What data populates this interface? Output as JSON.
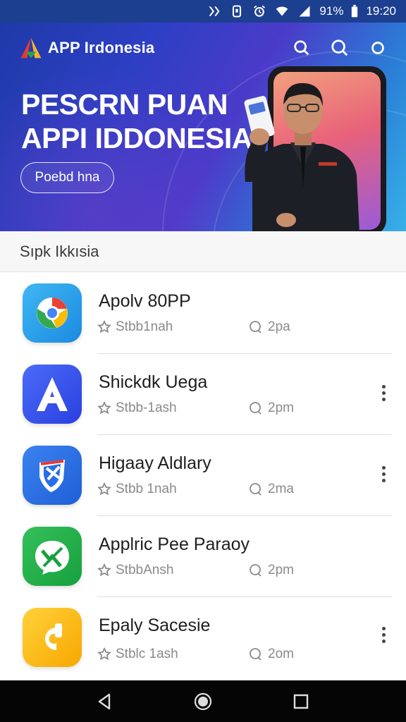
{
  "status_bar": {
    "battery": "91%",
    "time": "19:20",
    "icons": [
      "nfc-icon",
      "vibrate-icon",
      "alarm-icon",
      "wifi-icon",
      "signal-icon",
      "battery-icon"
    ]
  },
  "header": {
    "app_title": "APP Irdonesia",
    "actions": [
      "search-icon",
      "search-icon",
      "circle-icon"
    ]
  },
  "hero": {
    "title_line1": "PESCRN PUAN",
    "title_line2": "APPI IDDONESIA",
    "button_label": "Poebd hna"
  },
  "section": {
    "title": "Sıpk Ikkısia"
  },
  "apps": [
    {
      "name": "Apolv 80PP",
      "meta_left": "Stbb1nah",
      "meta_right": "2pa",
      "icon": "chrome-style-icon",
      "color": "#2fa4ea",
      "menu": false
    },
    {
      "name": "Shickdk Uega",
      "meta_left": "Stbb-1ash",
      "meta_right": "2pm",
      "icon": "letter-a-icon",
      "color": "#3558f0",
      "menu": true
    },
    {
      "name": "Higaay Aldlary",
      "meta_left": "Stbb 1nah",
      "meta_right": "2ma",
      "icon": "shield-icon",
      "color": "#2a6de8",
      "menu": true
    },
    {
      "name": "Applric Pee Paraoy",
      "meta_left": "StbbAnsh",
      "meta_right": "2pm",
      "icon": "chat-bubble-icon",
      "color": "#22b14c",
      "menu": false
    },
    {
      "name": "Epaly Sacesie",
      "meta_left": "Stblc 1ash",
      "meta_right": "2om",
      "icon": "letter-c-icon",
      "color": "#ffc21a",
      "menu": true
    }
  ],
  "nav": [
    "back-icon",
    "home-icon",
    "recents-icon"
  ]
}
